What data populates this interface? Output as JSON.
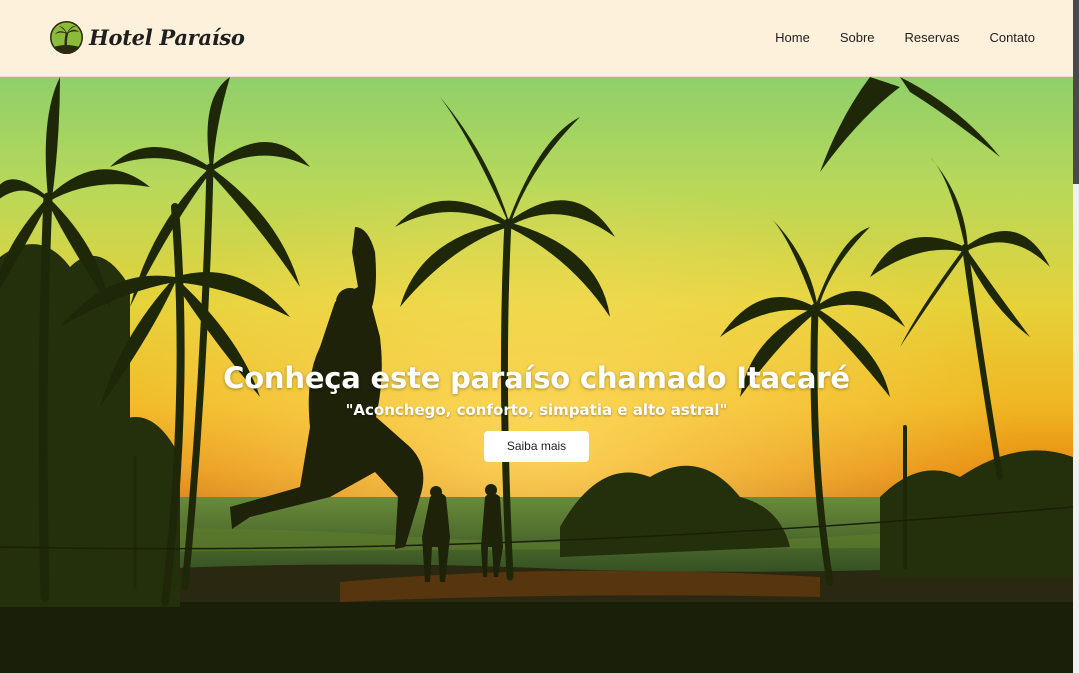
{
  "brand": {
    "name": "Hotel Paraíso",
    "logo_icon": "palm-tree-icon"
  },
  "nav": {
    "items": [
      {
        "label": "Home"
      },
      {
        "label": "Sobre"
      },
      {
        "label": "Reservas"
      },
      {
        "label": "Contato"
      }
    ]
  },
  "hero": {
    "title": "Conheça este paraíso chamado Itacaré",
    "subtitle": "\"Aconchego, conforto, simpatia e alto astral\"",
    "button_label": "Saiba mais",
    "image": "sunset beach palm trees slackline"
  },
  "colors": {
    "header_bg": "#fef1dc",
    "logo_green": "#8cba3a",
    "text_dark": "#1f1f1f",
    "button_bg": "#ffffff"
  }
}
